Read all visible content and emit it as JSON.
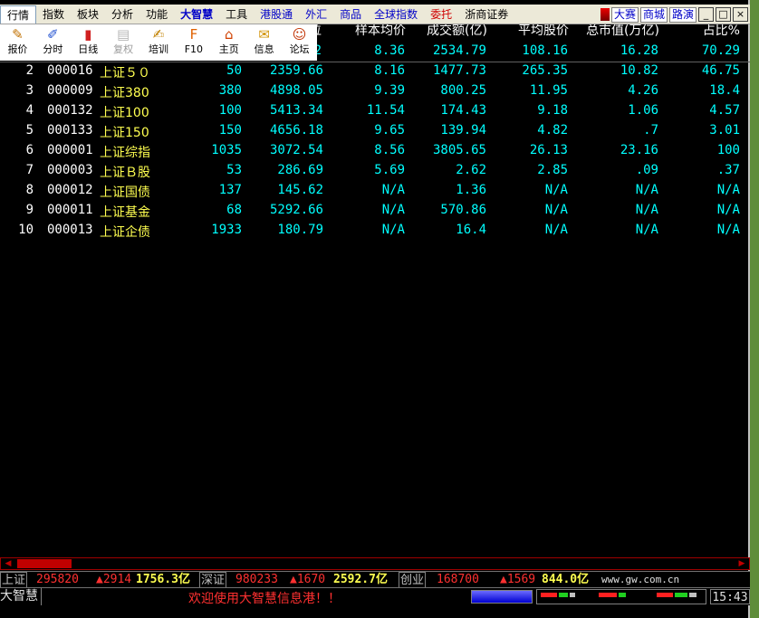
{
  "menu": {
    "items": [
      {
        "label": "行情",
        "style": "active"
      },
      {
        "label": "指数",
        "style": ""
      },
      {
        "label": "板块",
        "style": ""
      },
      {
        "label": "分析",
        "style": ""
      },
      {
        "label": "功能",
        "style": ""
      },
      {
        "label": "大智慧",
        "style": "bold-blue"
      },
      {
        "label": "工具",
        "style": ""
      },
      {
        "label": "港股通",
        "style": "blue"
      },
      {
        "label": "外汇",
        "style": "blue"
      },
      {
        "label": "商品",
        "style": "blue"
      },
      {
        "label": "全球指数",
        "style": "blue"
      },
      {
        "label": "委托",
        "style": "red"
      },
      {
        "label": "浙商证券",
        "style": ""
      }
    ],
    "right_buttons": [
      "大赛",
      "商城",
      "路演"
    ],
    "window_buttons": [
      "_",
      "□",
      "×"
    ]
  },
  "toolbar": [
    {
      "label": "报价",
      "icon": "pencil-icon",
      "glyph": "✎",
      "color": "#c07000",
      "disabled": false
    },
    {
      "label": "分时",
      "icon": "pen-chart-icon",
      "glyph": "✐",
      "color": "#2050d0",
      "disabled": false
    },
    {
      "label": "日线",
      "icon": "bar-chart-icon",
      "glyph": "▮",
      "color": "#d02020",
      "disabled": false
    },
    {
      "label": "复权",
      "icon": "book-icon",
      "glyph": "▤",
      "color": "#707070",
      "disabled": true
    },
    {
      "label": "培训",
      "icon": "training-icon",
      "glyph": "✍",
      "color": "#c08000",
      "disabled": false
    },
    {
      "label": "F10",
      "icon": "f10-icon",
      "glyph": "F",
      "color": "#e06000",
      "disabled": false
    },
    {
      "label": "主页",
      "icon": "home-icon",
      "glyph": "⌂",
      "color": "#d04000",
      "disabled": false
    },
    {
      "label": "信息",
      "icon": "mail-icon",
      "glyph": "✉",
      "color": "#d09000",
      "disabled": false
    },
    {
      "label": "论坛",
      "icon": "people-icon",
      "glyph": "☺",
      "color": "#c03000",
      "disabled": false
    }
  ],
  "header": {
    "col0_tail": "位",
    "sample_avg": "样本均价",
    "turnover": "成交额(亿)",
    "avg_price": "平均股价",
    "market_cap": "总市值(万亿)",
    "ratio": "占比%"
  },
  "first_row_partial": {
    "tail": "2",
    "sample_avg": "8.36",
    "turnover": "2534.79",
    "avg_price": "108.16",
    "market_cap": "16.28",
    "ratio": "70.29"
  },
  "rows": [
    {
      "idx": "2",
      "code": "000016",
      "name": "上证５０",
      "count": "50",
      "level": "2359.66",
      "sample_avg": "8.16",
      "turnover": "1477.73",
      "avg_price": "265.35",
      "market_cap": "10.82",
      "ratio": "46.75"
    },
    {
      "idx": "3",
      "code": "000009",
      "name": "上证380",
      "count": "380",
      "level": "4898.05",
      "sample_avg": "9.39",
      "turnover": "800.25",
      "avg_price": "11.95",
      "market_cap": "4.26",
      "ratio": "18.4"
    },
    {
      "idx": "4",
      "code": "000132",
      "name": "上证100",
      "count": "100",
      "level": "5413.34",
      "sample_avg": "11.54",
      "turnover": "174.43",
      "avg_price": "9.18",
      "market_cap": "1.06",
      "ratio": "4.57"
    },
    {
      "idx": "5",
      "code": "000133",
      "name": "上证150",
      "count": "150",
      "level": "4656.18",
      "sample_avg": "9.65",
      "turnover": "139.94",
      "avg_price": "4.82",
      "market_cap": ".7",
      "ratio": "3.01"
    },
    {
      "idx": "6",
      "code": "000001",
      "name": "上证综指",
      "count": "1035",
      "level": "3072.54",
      "sample_avg": "8.56",
      "turnover": "3805.65",
      "avg_price": "26.13",
      "market_cap": "23.16",
      "ratio": "100"
    },
    {
      "idx": "7",
      "code": "000003",
      "name": "上证Ｂ股",
      "count": "53",
      "level": "286.69",
      "sample_avg": "5.69",
      "turnover": "2.62",
      "avg_price": "2.85",
      "market_cap": ".09",
      "ratio": ".37"
    },
    {
      "idx": "8",
      "code": "000012",
      "name": "上证国债",
      "count": "137",
      "level": "145.62",
      "sample_avg": "N/A",
      "turnover": "1.36",
      "avg_price": "N/A",
      "market_cap": "N/A",
      "ratio": "N/A"
    },
    {
      "idx": "9",
      "code": "000011",
      "name": "上证基金",
      "count": "68",
      "level": "5292.66",
      "sample_avg": "N/A",
      "turnover": "570.86",
      "avg_price": "N/A",
      "market_cap": "N/A",
      "ratio": "N/A"
    },
    {
      "idx": "10",
      "code": "000013",
      "name": "上证企债",
      "count": "1933",
      "level": "180.79",
      "sample_avg": "N/A",
      "turnover": "16.4",
      "avg_price": "N/A",
      "market_cap": "N/A",
      "ratio": "N/A"
    }
  ],
  "status": {
    "sh_label": "上证",
    "sh_value": "295820",
    "sh_change": "▲2914",
    "sh_amount": "1756.3亿",
    "sz_label": "深证",
    "sz_value": "980233",
    "sz_change": "▲1670",
    "sz_amount": "2592.7亿",
    "cy_label": "创业",
    "cy_value": "168700",
    "cy_change": "▲1569",
    "cy_amount": "844.0亿",
    "website": "www.gw.com.cn",
    "app_name": "大智慧",
    "welcome": "欢迎使用大智慧信息港！！",
    "time": "15:43"
  },
  "colors": {
    "text_cyan": "#00ffff",
    "name_yellow": "#ffff50",
    "up_red": "#ff3030"
  }
}
